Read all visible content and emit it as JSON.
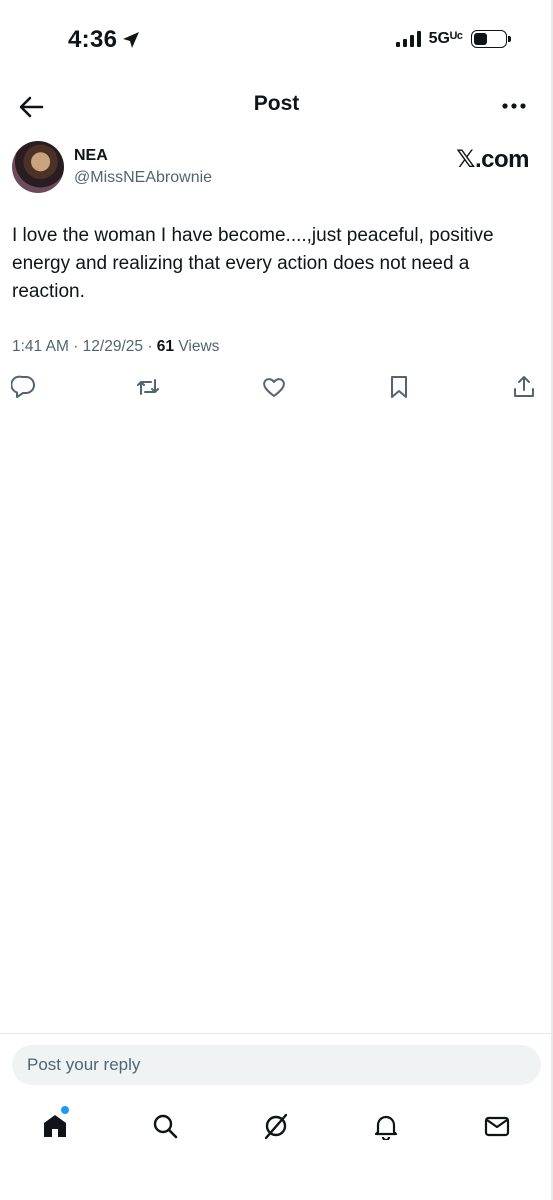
{
  "status_bar": {
    "time": "4:36",
    "network": "5Gᵁᶜ"
  },
  "header": {
    "title": "Post"
  },
  "post": {
    "author_name": "NEA",
    "author_handle": "@MissNEAbrownie",
    "watermark": "𝕏.com",
    "text": "I love the woman I have become....,just peaceful, positive energy and realizing that every action does not need a reaction.",
    "time": "1:41 AM",
    "date": "12/29/25",
    "views_count": "61",
    "views_label": "Views"
  },
  "actions": [
    "reply-icon",
    "repost-icon",
    "like-icon",
    "bookmark-icon",
    "share-icon"
  ],
  "reply": {
    "placeholder": "Post your reply"
  },
  "tabs": [
    "home-icon",
    "search-icon",
    "grok-icon",
    "notifications-icon",
    "messages-icon"
  ],
  "colors": {
    "text": "#0f1419",
    "secondary": "#536471",
    "accent": "#1d9bf0",
    "reply_bg": "#eff3f4"
  }
}
